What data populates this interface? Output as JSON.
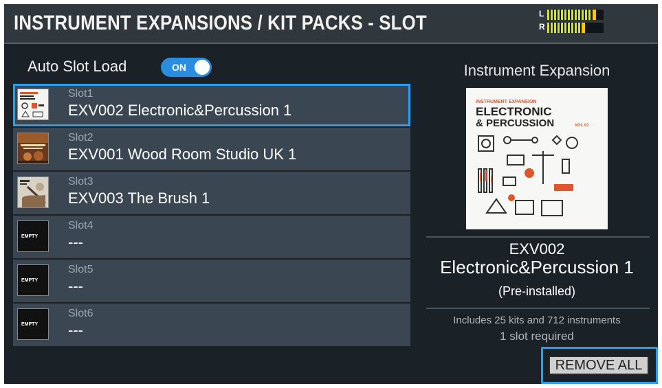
{
  "header": {
    "title": "INSTRUMENT EXPANSIONS / KIT PACKS - SLOT",
    "meter": {
      "left_label": "L",
      "right_label": "R",
      "left_level": 0.78,
      "right_level": 0.58,
      "accent": "#f5c518"
    }
  },
  "auto_slot_load": {
    "label": "Auto Slot Load",
    "toggle_label": "ON",
    "state": "on",
    "accent": "#2b8de0"
  },
  "slots": [
    {
      "slot": "Slot1",
      "name": "EXV002 Electronic&Percussion 1",
      "selected": true,
      "thumb": "electronic-percussion-cover"
    },
    {
      "slot": "Slot2",
      "name": "EXV001  Wood Room Studio UK 1",
      "selected": false,
      "thumb": "wood-room-studio-cover"
    },
    {
      "slot": "Slot3",
      "name": "EXV003 The Brush 1",
      "selected": false,
      "thumb": "the-brush-cover"
    },
    {
      "slot": "Slot4",
      "name": "---",
      "selected": false,
      "thumb_text": "EMPTY"
    },
    {
      "slot": "Slot5",
      "name": "---",
      "selected": false,
      "thumb_text": "EMPTY"
    },
    {
      "slot": "Slot6",
      "name": "---",
      "selected": false,
      "thumb_text": "EMPTY"
    }
  ],
  "detail": {
    "heading": "Instrument Expansion",
    "cover": {
      "top_text": "INSTRUMENT EXPANSION",
      "line1": "ELECTRONIC",
      "line2": "& PERCUSSION",
      "vol": "VOL.01"
    },
    "code": "EXV002",
    "name": "Electronic&Percussion 1",
    "status": "(Pre-installed)",
    "info": "Includes 25 kits and 712 instruments",
    "requirement": "1 slot required"
  },
  "actions": {
    "remove_all": "REMOVE ALL"
  },
  "colors": {
    "selection": "#2a9ef0",
    "background": "#1b2227",
    "row": "#3a4752"
  }
}
